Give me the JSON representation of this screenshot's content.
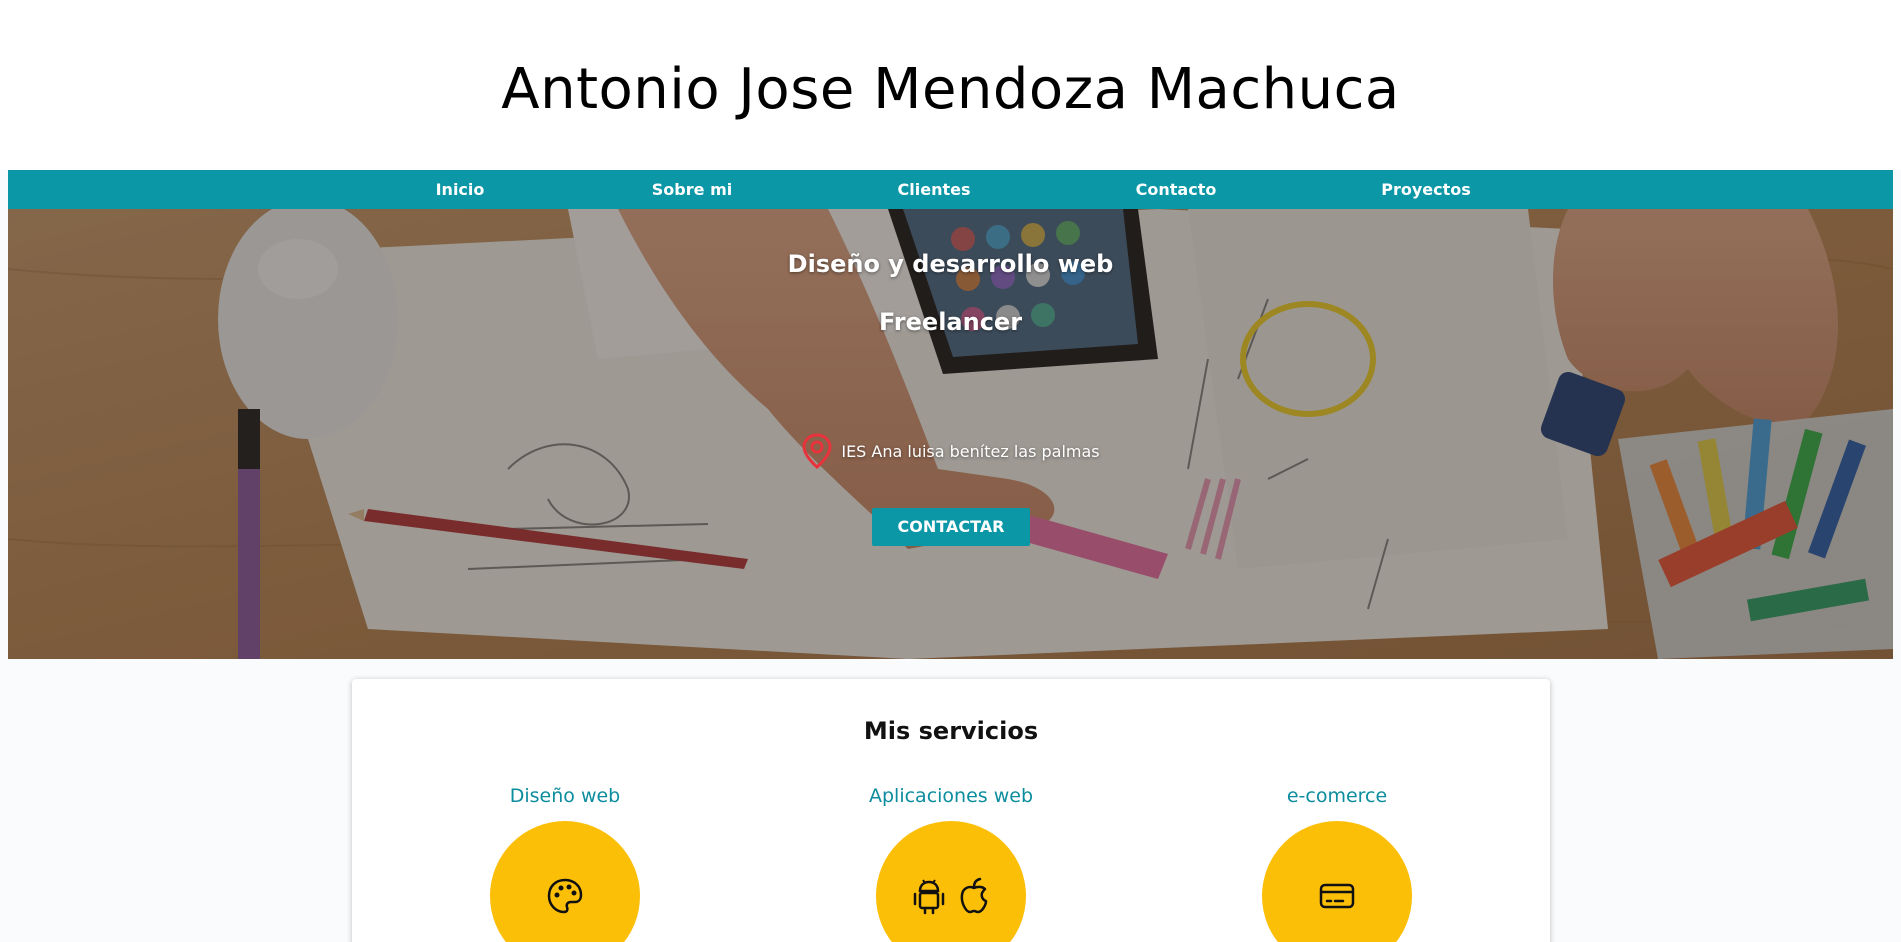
{
  "header": {
    "title": "Antonio Jose Mendoza Machuca"
  },
  "nav": {
    "items": [
      {
        "label": "Inicio"
      },
      {
        "label": "Sobre mi"
      },
      {
        "label": "Clientes"
      },
      {
        "label": "Contacto"
      },
      {
        "label": "Proyectos"
      }
    ]
  },
  "hero": {
    "headline": "Diseño y desarrollo web",
    "subheadline": "Freelancer",
    "location": "IES Ana luisa benítez las palmas",
    "location_icon": "map-pin-icon",
    "cta_label": "CONTACTAR"
  },
  "services": {
    "title": "Mis servicios",
    "items": [
      {
        "title": "Diseño web",
        "icons": [
          "palette-icon"
        ]
      },
      {
        "title": "Aplicaciones web",
        "icons": [
          "android-icon",
          "apple-icon"
        ]
      },
      {
        "title": "e-comerce",
        "icons": [
          "credit-card-icon"
        ]
      }
    ]
  },
  "colors": {
    "accent": "#0c97a7",
    "service_circle": "#fcbf08",
    "location_pin": "#e8323c"
  }
}
